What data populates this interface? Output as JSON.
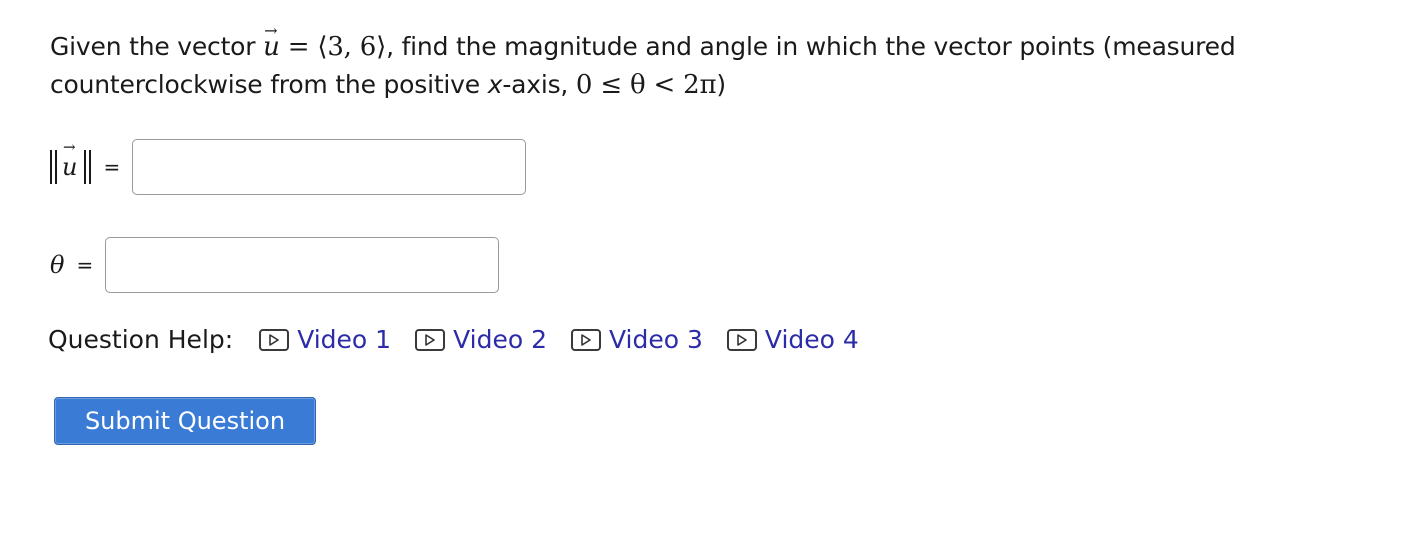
{
  "question": {
    "intro": "Given the vector ",
    "vector_var": "u",
    "equals": " = ",
    "vector_value": "⟨3, 6⟩",
    "middle": ", find the magnitude and angle in which the vector points (measured counterclockwise from the positive ",
    "axis_var": "x",
    "axis_suffix": "-axis, ",
    "range": "0 ≤ θ < 2π",
    "closing": ")"
  },
  "magnitude": {
    "var": "u",
    "equals": "=",
    "value": ""
  },
  "angle": {
    "var": "θ",
    "equals": "=",
    "value": ""
  },
  "help": {
    "label": "Question Help:",
    "videos": [
      {
        "label": "Video 1",
        "icon": "play-icon"
      },
      {
        "label": "Video 2",
        "icon": "play-icon"
      },
      {
        "label": "Video 3",
        "icon": "play-icon"
      },
      {
        "label": "Video 4",
        "icon": "play-icon"
      }
    ]
  },
  "submit": {
    "label": "Submit Question"
  },
  "colors": {
    "link": "#2c2ca8",
    "button": "#3a7bd5"
  }
}
